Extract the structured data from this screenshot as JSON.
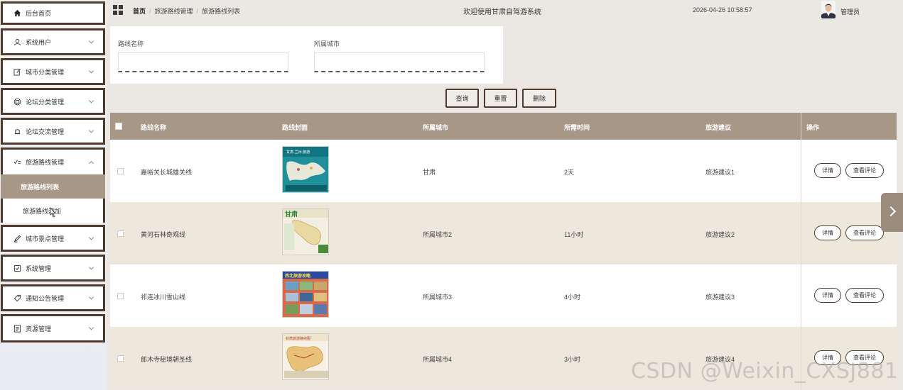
{
  "sidebar": {
    "home": "后台首页",
    "menus": [
      {
        "label": "系统用户",
        "icon": "user-icon"
      },
      {
        "label": "城市分类管理",
        "icon": "edit-icon"
      },
      {
        "label": "论坛分类管理",
        "icon": "chat-icon"
      },
      {
        "label": "论坛交流管理",
        "icon": "bell-icon"
      },
      {
        "label": "旅游路线管理",
        "icon": "list-icon",
        "expanded": true
      },
      {
        "label": "城市景点管理",
        "icon": "pen-icon"
      },
      {
        "label": "系统管理",
        "icon": "check-icon"
      },
      {
        "label": "通知公告管理",
        "icon": "tag-icon"
      },
      {
        "label": "资源管理",
        "icon": "document-icon"
      }
    ],
    "submenu": [
      {
        "label": "旅游路线列表",
        "active": true
      },
      {
        "label": "旅游路线添加",
        "active": false
      }
    ]
  },
  "header": {
    "breadcrumb": [
      "首页",
      "旅游路线管理",
      "旅游路线列表"
    ],
    "welcome": "欢迎使用甘肃自驾游系统",
    "datetime": "2026-04-26 10:58:57",
    "user": "管理员"
  },
  "search": {
    "route_name_label": "路线名称",
    "route_name_value": "",
    "city_label": "所属城市",
    "city_value": ""
  },
  "buttons": {
    "query": "查询",
    "reset": "重置",
    "delete": "删除"
  },
  "table": {
    "columns": [
      "路线名称",
      "路线封面",
      "所属城市",
      "所需时间",
      "旅游建议",
      "操作"
    ],
    "rows": [
      {
        "name": "嘉峪关长城雄关线",
        "city": "甘肃",
        "time": "2天",
        "advice": "旅游建议1"
      },
      {
        "name": "黄河石林奇观线",
        "city": "所属城市2",
        "time": "11小时",
        "advice": "旅游建议2"
      },
      {
        "name": "祁连冰川雪山线",
        "city": "所属城市3",
        "time": "4小时",
        "advice": "旅游建议3"
      },
      {
        "name": "郎木寺秘境朝圣线",
        "city": "所属城市4",
        "time": "3小时",
        "advice": "旅游建议4"
      }
    ],
    "actions": {
      "detail": "详情",
      "comment": "查看评论"
    }
  },
  "thumbnails": {
    "t1": "甘肃·兰州·旅游",
    "t2": "甘肃",
    "t3": "西北旅游攻略",
    "t4": "甘肃旅游路线图"
  },
  "watermark": "CSDN @Weixin_CXSJ881",
  "colors": {
    "accent": "#a79786",
    "border": "#4e3a2e",
    "row_alt": "#ede7dc",
    "background": "#ebe8e4"
  }
}
